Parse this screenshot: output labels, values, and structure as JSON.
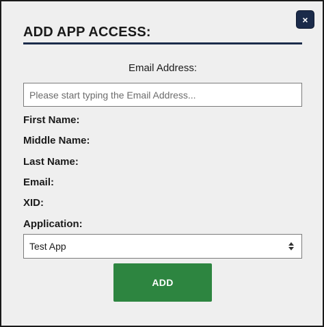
{
  "modal": {
    "title": "ADD APP ACCESS:",
    "close_label": "×"
  },
  "email": {
    "label": "Email Address:",
    "placeholder": "Please start typing the Email Address...",
    "value": ""
  },
  "fields": {
    "first_name": "First Name:",
    "middle_name": "Middle Name:",
    "last_name": "Last Name:",
    "email": "Email:",
    "xid": "XID:",
    "application": "Application:"
  },
  "application_select": {
    "selected": "Test App"
  },
  "actions": {
    "add_label": "ADD"
  },
  "colors": {
    "accent_navy": "#1b2b4a",
    "add_green": "#2d8540",
    "modal_background": "#efefef"
  },
  "icons": {
    "close": "close-icon",
    "select": "select-arrows-icon"
  }
}
